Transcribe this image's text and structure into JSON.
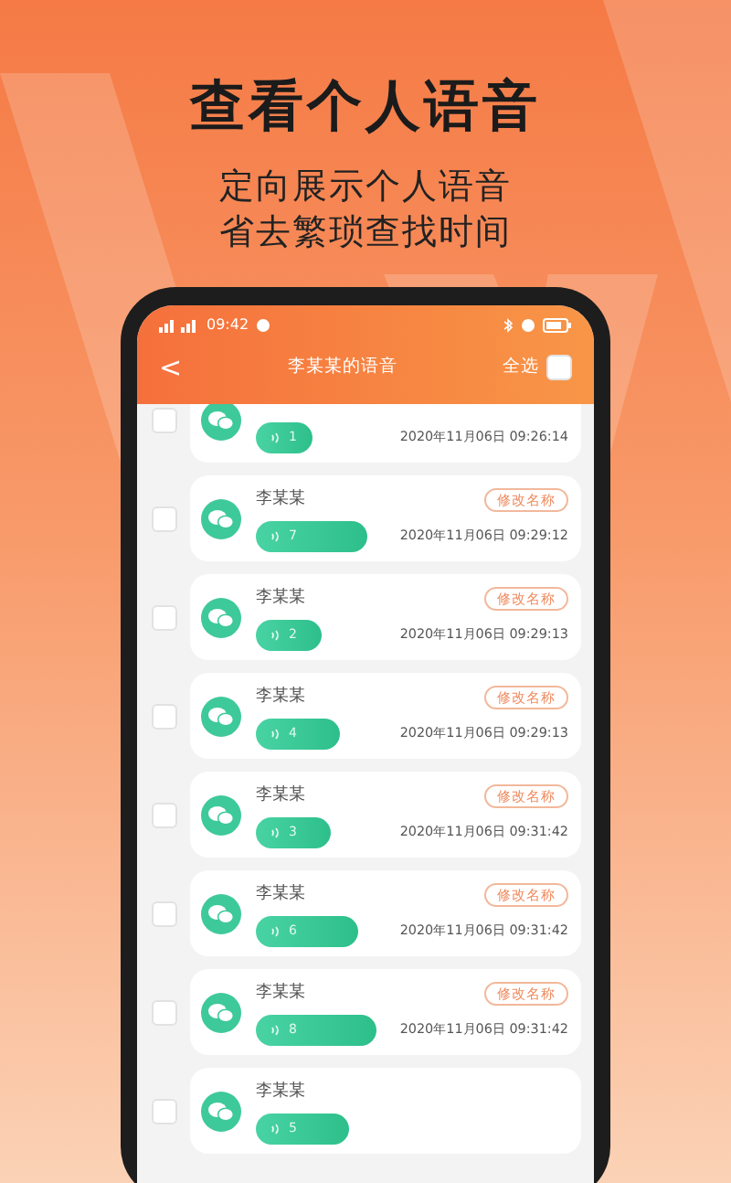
{
  "headline": "查看个人语音",
  "subtitle_lines": [
    "定向展示个人语音",
    "省去繁琐查找时间"
  ],
  "status_bar": {
    "time": "09:42"
  },
  "header": {
    "back": "<",
    "title": "李某某的语音",
    "select_all": {
      "label": "全选",
      "checked": false
    }
  },
  "voice_items": [
    {
      "duration": "1",
      "date": "2020年11月06日 09:26:14",
      "checked": false
    },
    {
      "name": "李某某",
      "rename": "修改名称",
      "duration": "7",
      "date": "2020年11月06日 09:29:12",
      "checked": false
    },
    {
      "name": "李某某",
      "rename": "修改名称",
      "duration": "2",
      "date": "2020年11月06日 09:29:13",
      "checked": false
    },
    {
      "name": "李某某",
      "rename": "修改名称",
      "duration": "4",
      "date": "2020年11月06日 09:29:13",
      "checked": false
    },
    {
      "name": "李某某",
      "rename": "修改名称",
      "duration": "3",
      "date": "2020年11月06日 09:31:42",
      "checked": false
    },
    {
      "name": "李某某",
      "rename": "修改名称",
      "duration": "6",
      "date": "2020年11月06日 09:31:42",
      "checked": false
    },
    {
      "name": "李某某",
      "rename": "修改名称",
      "duration": "8",
      "date": "2020年11月06日 09:31:42",
      "checked": false
    },
    {
      "name": "李某某",
      "duration": "5",
      "checked": false
    }
  ]
}
